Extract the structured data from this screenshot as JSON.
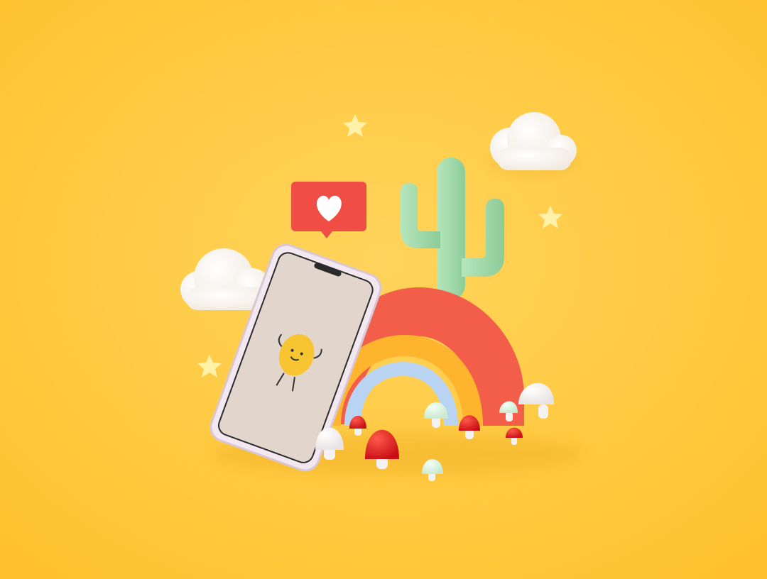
{
  "scene": {
    "colors": {
      "background": "#FFC93C",
      "background_light": "#FFD45C",
      "rainbow_outer": "#F25E4A",
      "rainbow_middle": "#FFB42E",
      "rainbow_inner": "#B9D3F2",
      "cactus": "#9ED9A6",
      "like_badge": "#F04E45",
      "heart": "#FFFFFF",
      "cloud": "#FFFFFF",
      "star": "#FFF2A8",
      "phone_frame": "#F3E8F0",
      "phone_screen": "#E2D6CC",
      "character": "#F7C531",
      "mushroom_red": "#E32222",
      "mushroom_white": "#F4F2F2",
      "mushroom_mint": "#D8F0DE"
    },
    "objects": [
      "phone",
      "rainbow",
      "cactus",
      "like-heart-badge",
      "cloud-left",
      "cloud-right",
      "stars",
      "mushrooms",
      "cartoon-character"
    ]
  }
}
